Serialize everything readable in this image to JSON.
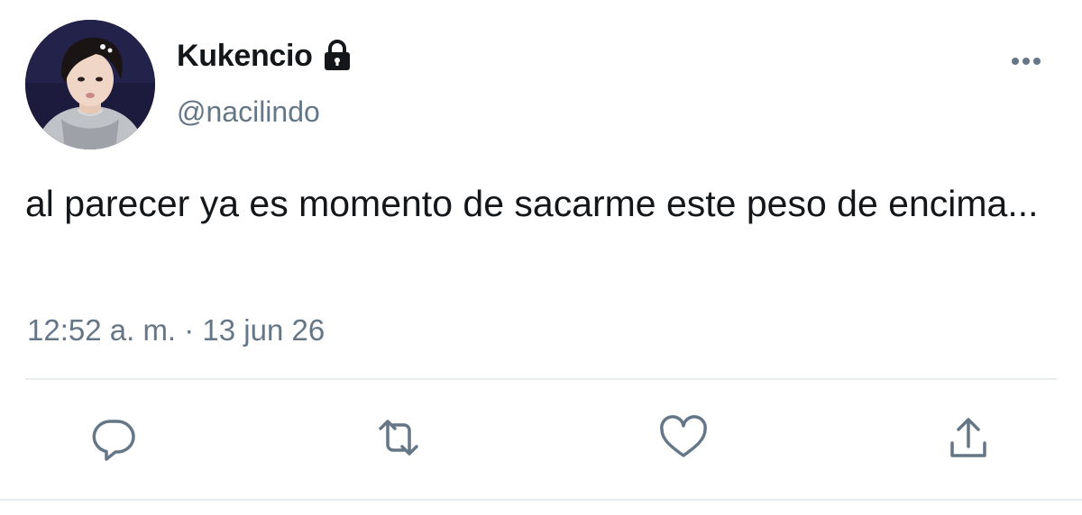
{
  "user": {
    "display_name": "Kukencio",
    "handle": "@nacilindo",
    "protected_icon": "lock-icon",
    "avatar": "avatar-photo"
  },
  "tweet": {
    "text": "al parecer ya es momento de sacarme este peso de encima...",
    "timestamp": "12:52 a. m. · 13 jun 26"
  },
  "actions": {
    "reply_icon": "reply-icon",
    "retweet_icon": "retweet-icon",
    "like_icon": "heart-icon",
    "share_icon": "share-icon",
    "more_icon": "more-options-icon"
  },
  "colors": {
    "text_primary": "#14171a",
    "text_secondary": "#657786",
    "divider": "#e6ecf0"
  }
}
